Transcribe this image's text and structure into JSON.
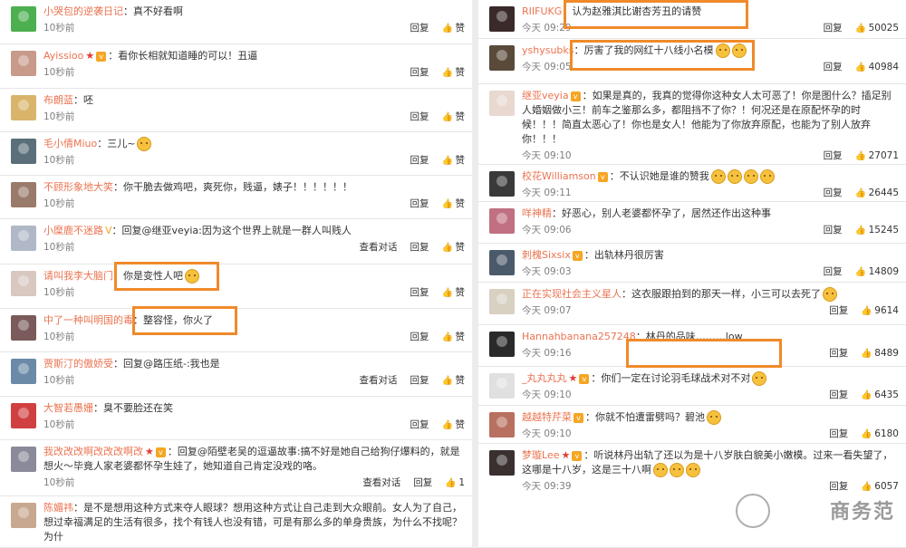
{
  "ui": {
    "reply": "回复",
    "like": "赞",
    "view_dialog": "查看对话"
  },
  "left": [
    {
      "user": "小哭包的逆袭日记",
      "text": "：真不好看啊",
      "time": "10秒前",
      "emoji": 0,
      "dialog": false,
      "likes": null,
      "color": "#4caf50"
    },
    {
      "user": "Ayissioo",
      "badge": "star",
      "text": "：看你长相就知道睡的可以！丑逼",
      "time": "10秒前",
      "emoji": 0,
      "dialog": false,
      "likes": null,
      "color": "#c79a8a"
    },
    {
      "user": "布朗蓝",
      "text": "：呸",
      "time": "10秒前",
      "emoji": 0,
      "dialog": false,
      "likes": null,
      "color": "#d9b46a"
    },
    {
      "user": "毛小倩Miuo",
      "text": "：三儿~",
      "time": "10秒前",
      "emoji": 1,
      "dialog": false,
      "likes": null,
      "color": "#5a6f7a"
    },
    {
      "user": "不顾形象地大笑",
      "text": "：你干脆去做鸡吧，爽死你，贱逼，婊子！！！！！！",
      "time": "10秒前",
      "emoji": 0,
      "dialog": false,
      "likes": null,
      "color": "#9a7a6a"
    },
    {
      "user": "小糜鹿不迷路",
      "badge": "v",
      "text": "：回复@继亚veyia:因为这个世界上就是一群人叫贱人",
      "time": "10秒前",
      "emoji": 0,
      "dialog": true,
      "likes": null,
      "color": "#b0b8c8"
    },
    {
      "user": "请叫我李大脑门",
      "text": "：你是变性人吧",
      "time": "10秒前",
      "emoji": 1,
      "dialog": false,
      "likes": null,
      "color": "#d8c8c0"
    },
    {
      "user": "中了一种叫明国的毒",
      "text": "：整容怪，你火了",
      "time": "10秒前",
      "emoji": 0,
      "dialog": false,
      "likes": null,
      "color": "#7a5a5a"
    },
    {
      "user": "贾斯汀的傲娇受",
      "text": "：回复@路压纸-:我也是",
      "time": "10秒前",
      "emoji": 0,
      "dialog": true,
      "likes": null,
      "color": "#6a8aa8"
    },
    {
      "user": "大智若愚姗",
      "text": "：臭不要脸还在笑",
      "time": "10秒前",
      "emoji": 0,
      "dialog": false,
      "likes": null,
      "color": "#d04040"
    },
    {
      "user": "我改改改啊改改改啊改",
      "badge": "star",
      "text": "：回复@陌壁老吴的逗逼故事:搞不好是她自己给狗仔爆料的，就是想火～毕竟人家老婆都怀孕生娃了，她知道自己肯定没戏的咯。",
      "time": "10秒前",
      "emoji": 0,
      "dialog": true,
      "likes": "1",
      "color": "#8a8a9a"
    },
    {
      "user": "陈媚祎",
      "text": "：是不是想用这种方式来夺人眼球？想用这种方式让自己走到大众眼前。女人为了自己，想过幸福满足的生活有很多，找个有钱人也没有错，可是有那么多的单身贵族，为什么不找呢？为什",
      "time": "",
      "emoji": 0,
      "dialog": false,
      "likes": null,
      "color": "#c8a890"
    }
  ],
  "right": [
    {
      "user": "RIIFUKG",
      "text": "：认为赵雅淇比谢杏芳丑的请赞",
      "time": "今天 09:29",
      "emoji": 0,
      "likes": "50025",
      "color": "#3a2a2a"
    },
    {
      "user": "yshysubks",
      "text": "：厉害了我的网红十八线小名模",
      "time": "今天 09:05",
      "emoji": 2,
      "likes": "40984",
      "color": "#5a4a3a"
    },
    {
      "user": "继亚veyia",
      "badge": "vip",
      "text": "：如果是真的，我真的觉得你这种女人太可恶了！你是图什么？插足别人婚姻做小三！前车之鉴那么多，都阻挡不了你？！何况还是在原配怀孕的时候！！！简直太恶心了！你也是女人！他能为了你放弃原配，也能为了别人放弃你！！！",
      "time": "今天 09:10",
      "emoji": 0,
      "likes": "27071",
      "color": "#e8d8d0"
    },
    {
      "user": "校花Williamson",
      "badge": "vip",
      "text": "：不认识她是谁的赞我",
      "time": "今天 09:11",
      "emoji": 4,
      "likes": "26445",
      "color": "#3a3a3a"
    },
    {
      "user": "咩神精",
      "text": "：好恶心，别人老婆都怀孕了，居然还作出这种事",
      "time": "今天 09:06",
      "emoji": 0,
      "likes": "15245",
      "color": "#c07080"
    },
    {
      "user": "刺槐Sixsix",
      "badge": "vip",
      "text": "：出轨林丹很厉害",
      "time": "今天 09:03",
      "emoji": 0,
      "likes": "14809",
      "color": "#4a5a6a"
    },
    {
      "user": "正在实现社会主义星人",
      "text": "：这衣服跟拍到的那天一样，小三可以去死了",
      "time": "今天 09:07",
      "emoji": 1,
      "likes": "9614",
      "color": "#d8d0c0"
    },
    {
      "user": "Hannahbanana257248",
      "text": "：林丹的品味………low",
      "time": "今天 09:16",
      "emoji": 0,
      "likes": "8489",
      "color": "#2a2a2a"
    },
    {
      "user": "_丸丸丸丸",
      "badge": "star",
      "text": "：你们一定在讨论羽毛球战术对不对",
      "time": "今天 09:10",
      "emoji": 1,
      "likes": "6435",
      "color": "#e0e0e0"
    },
    {
      "user": "越越特芹菜",
      "badge": "vip",
      "text": "：你就不怕遭雷劈吗？碧池",
      "time": "今天 09:10",
      "emoji": 1,
      "likes": "6180",
      "color": "#b87060"
    },
    {
      "user": "梦璇Lee",
      "badge": "star",
      "text": "：听说林丹出轨了还以为是十八岁肤白貌美小嫩模。过来一看失望了，这哪是十八岁，这是三十八啊",
      "time": "今天 09:39",
      "emoji": 3,
      "likes": "6057",
      "color": "#3a3030"
    }
  ],
  "watermark": "商务范"
}
